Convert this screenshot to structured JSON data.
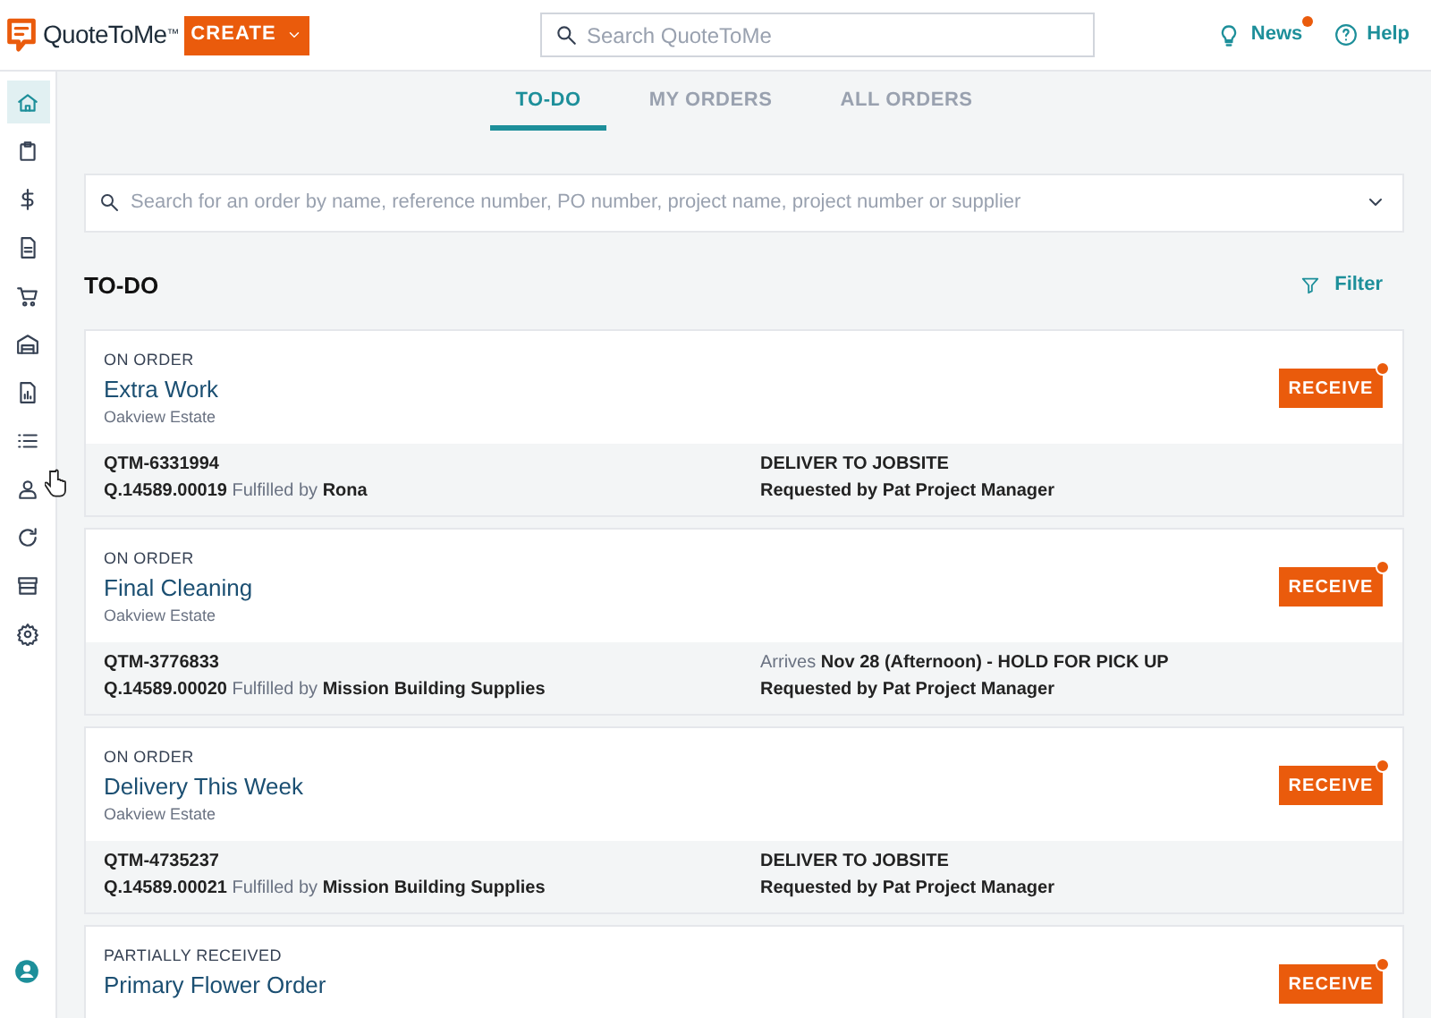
{
  "header": {
    "logo": "QuoteToMe",
    "logo_mark": "™",
    "create_button": "CREATE",
    "search": {
      "placeholder": "Search QuoteToMe"
    },
    "news": {
      "label": "News",
      "unread": true
    },
    "help": "Help"
  },
  "sidebar": {
    "items": [
      {
        "kind": "home",
        "selected": true
      },
      {
        "kind": "clipboard",
        "selected": false
      },
      {
        "kind": "dollar",
        "selected": false
      },
      {
        "kind": "document",
        "selected": false
      },
      {
        "kind": "cart",
        "selected": false
      },
      {
        "kind": "warehouse",
        "selected": false
      },
      {
        "kind": "report",
        "selected": false
      },
      {
        "kind": "list",
        "selected": false
      },
      {
        "kind": "person",
        "selected": false
      },
      {
        "kind": "refresh",
        "selected": false
      },
      {
        "kind": "store",
        "selected": false
      },
      {
        "kind": "gear",
        "selected": false
      }
    ],
    "account": {
      "kind": "account"
    }
  },
  "tabs": [
    {
      "label": "TO-DO",
      "selected": true
    },
    {
      "label": "MY ORDERS",
      "selected": false
    },
    {
      "label": "ALL ORDERS",
      "selected": false
    }
  ],
  "order_search": {
    "placeholder": "Search for an order by name, reference number, PO number, project name, project number or supplier"
  },
  "section": {
    "title": "TO-DO",
    "filter": "Filter"
  },
  "orders": [
    {
      "status": "ON ORDER",
      "name": "Extra Work",
      "project": "Oakview Estate",
      "button": "RECEIVE",
      "notification": true,
      "quote_number": "QTM-6331994",
      "fulfillment": "**Q.14589.00019** Fulfilled by **Rona**",
      "delivery": "**DELIVER TO JOBSITE**",
      "requested_by": "Requested by Pat Project Manager"
    },
    {
      "status": "ON ORDER",
      "name": "Final Cleaning",
      "project": "Oakview Estate",
      "button": "RECEIVE",
      "notification": true,
      "quote_number": "QTM-3776833",
      "fulfillment": "**Q.14589.00020** Fulfilled by **Mission Building Supplies**",
      "delivery": "Arrives **Nov 28 (Afternoon) - HOLD FOR PICK UP**",
      "requested_by": "Requested by Pat Project Manager"
    },
    {
      "status": "ON ORDER",
      "name": "Delivery This Week",
      "project": "Oakview Estate",
      "button": "RECEIVE",
      "notification": true,
      "quote_number": "QTM-4735237",
      "fulfillment": "**Q.14589.00021** Fulfilled by **Mission Building Supplies**",
      "delivery": "**DELIVER TO JOBSITE**",
      "requested_by": "Requested by Pat Project Manager"
    },
    {
      "status": "PARTIALLY RECEIVED",
      "name": "Primary Flower Order",
      "button": "RECEIVE",
      "notification": true
    }
  ]
}
